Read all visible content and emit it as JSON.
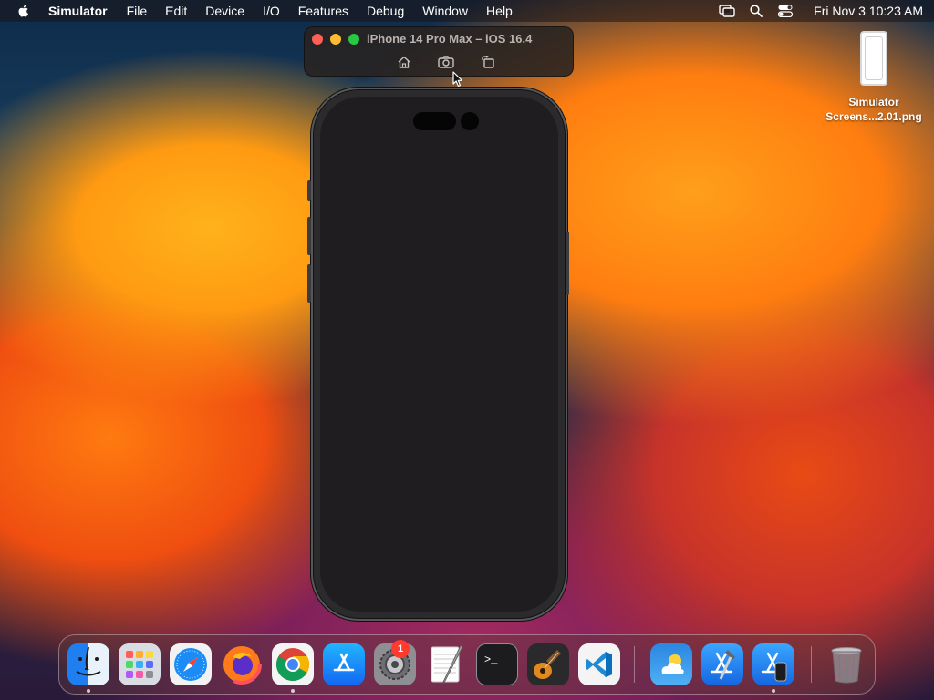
{
  "menubar": {
    "apple_icon": "apple-icon",
    "app_name": "Simulator",
    "items": [
      "File",
      "Edit",
      "Device",
      "I/O",
      "Features",
      "Debug",
      "Window",
      "Help"
    ],
    "status_icons": [
      "screen-mirroring-icon",
      "search-icon",
      "control-center-icon"
    ],
    "clock": "Fri Nov 3  10:23 AM"
  },
  "simulator": {
    "title": "iPhone 14 Pro Max – iOS 16.4",
    "buttons": [
      "home-icon",
      "screenshot-icon",
      "rotate-icon"
    ]
  },
  "desktop": {
    "file_name_line1": "Simulator",
    "file_name_line2": "Screens...2.01.png"
  },
  "dock": {
    "apps": [
      {
        "name": "Finder",
        "running": true
      },
      {
        "name": "Launchpad",
        "running": false
      },
      {
        "name": "Safari",
        "running": false
      },
      {
        "name": "Firefox",
        "running": false
      },
      {
        "name": "Google Chrome",
        "running": true
      },
      {
        "name": "App Store",
        "running": false
      },
      {
        "name": "System Settings",
        "running": false,
        "badge": "1"
      },
      {
        "name": "TextEdit",
        "running": false
      },
      {
        "name": "Terminal",
        "running": false
      },
      {
        "name": "GarageBand",
        "running": false
      },
      {
        "name": "Visual Studio Code",
        "running": false
      },
      {
        "name": "Weather",
        "running": false
      },
      {
        "name": "Xcode",
        "running": false
      },
      {
        "name": "Simulator",
        "running": true
      },
      {
        "name": "Trash",
        "running": false
      }
    ],
    "settings_badge": "1"
  },
  "colors": {
    "close": "#ff5f57",
    "minimize": "#febc2e",
    "zoom": "#28c840",
    "badge": "#ff3b30"
  }
}
